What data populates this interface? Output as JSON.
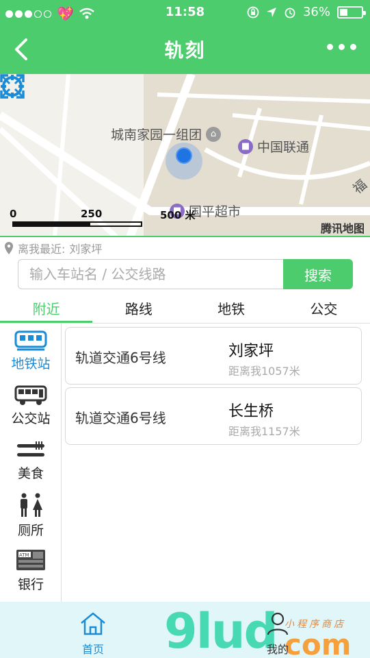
{
  "status_bar": {
    "time": "11:58",
    "battery": "36%",
    "battery_level": 0.36
  },
  "nav": {
    "title": "轨刻",
    "back_icon": "chevron-left-icon",
    "more_icon": "more-dots-icon"
  },
  "map": {
    "pois": [
      {
        "label": "城南家园一组团",
        "icon": "home-icon"
      },
      {
        "label": "中国联通",
        "icon": "poi-icon"
      },
      {
        "label": "国平超市",
        "icon": "poi-icon"
      },
      {
        "label": "福"
      }
    ],
    "scale_labels": [
      "0",
      "250",
      "500 米"
    ],
    "provider": "腾讯地图"
  },
  "search": {
    "nearest_prefix": "离我最近:",
    "nearest_station": "刘家坪",
    "placeholder": "输入车站名 / 公交线路",
    "button_label": "搜索"
  },
  "tabs": [
    {
      "label": "附近",
      "active": true
    },
    {
      "label": "路线",
      "active": false
    },
    {
      "label": "地铁",
      "active": false
    },
    {
      "label": "公交",
      "active": false
    }
  ],
  "categories": [
    {
      "label": "地铁站",
      "icon": "metro-icon",
      "active": true
    },
    {
      "label": "公交站",
      "icon": "bus-icon",
      "active": false
    },
    {
      "label": "美食",
      "icon": "food-icon",
      "active": false
    },
    {
      "label": "厕所",
      "icon": "restroom-icon",
      "active": false
    },
    {
      "label": "银行",
      "icon": "atm-icon",
      "active": false
    }
  ],
  "stations": [
    {
      "line": "轨道交通6号线",
      "name": "刘家坪",
      "distance": "距离我1057米"
    },
    {
      "line": "轨道交通6号线",
      "name": "长生桥",
      "distance": "距离我1157米"
    }
  ],
  "tabbar": {
    "home_label": "首页",
    "mine_label": "我的"
  },
  "watermark": {
    "brand": "9lud",
    "com": "com",
    "subtitle": "小程序商店"
  },
  "colors": {
    "brand_green": "#4dcc6e",
    "accent_blue": "#1a8bd6",
    "tabbar_bg": "#e0f6f8"
  }
}
